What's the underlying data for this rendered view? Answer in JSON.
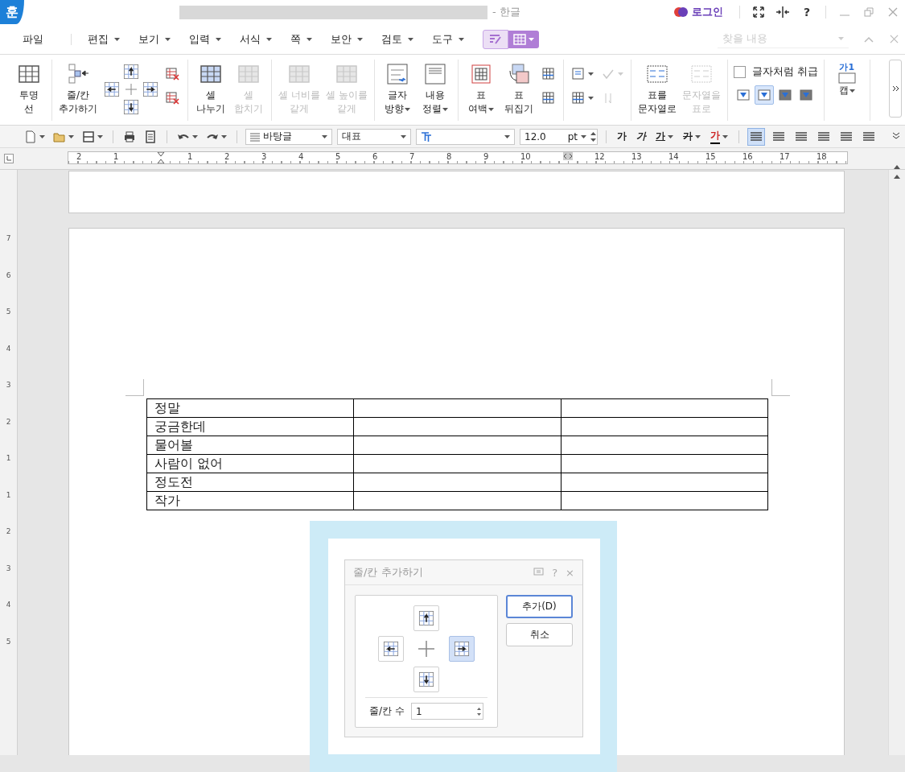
{
  "title_bar": {
    "logo": "훈",
    "app_name": "- 한글",
    "login": "로그인",
    "help": "?"
  },
  "menu": [
    {
      "label": "파일",
      "dropdown": false
    },
    {
      "label": "편집",
      "dropdown": true
    },
    {
      "label": "보기",
      "dropdown": true
    },
    {
      "label": "입력",
      "dropdown": true
    },
    {
      "label": "서식",
      "dropdown": true
    },
    {
      "label": "쪽",
      "dropdown": true
    },
    {
      "label": "보안",
      "dropdown": true
    },
    {
      "label": "검토",
      "dropdown": true
    },
    {
      "label": "도구",
      "dropdown": true
    }
  ],
  "mode_tabs": [
    {
      "selected": false
    },
    {
      "selected": true
    }
  ],
  "search": {
    "placeholder": "찾을 내용"
  },
  "ribbon": [
    {
      "items": [
        {
          "kind": "large",
          "lines": [
            "투명",
            "선"
          ],
          "disabled": false,
          "dropdown": false
        }
      ]
    },
    {
      "items": [
        {
          "kind": "large",
          "lines": [
            "줄/칸",
            "추가하기"
          ],
          "disabled": false,
          "dropdown": false
        },
        {
          "kind": "cross"
        },
        {
          "kind": "stack",
          "items": [
            {
              "kind": "small",
              "disabled": false,
              "dropdown": false
            },
            {
              "kind": "small",
              "disabled": false,
              "dropdown": false
            }
          ]
        }
      ]
    },
    {
      "items": [
        {
          "kind": "large",
          "lines": [
            "셀",
            "나누기"
          ],
          "disabled": false,
          "dropdown": false
        },
        {
          "kind": "large",
          "lines": [
            "셀",
            "합치기"
          ],
          "disabled": true,
          "dropdown": false
        }
      ]
    },
    {
      "items": [
        {
          "kind": "large",
          "lines": [
            "셀 너비를",
            "같게"
          ],
          "disabled": true,
          "dropdown": false
        },
        {
          "kind": "large",
          "lines": [
            "셀 높이를",
            "같게"
          ],
          "disabled": true,
          "dropdown": false
        }
      ]
    },
    {
      "items": [
        {
          "kind": "large",
          "lines": [
            "글자",
            "방향"
          ],
          "disabled": false,
          "dropdown": true
        },
        {
          "kind": "large",
          "lines": [
            "내용",
            "정렬"
          ],
          "disabled": false,
          "dropdown": true
        }
      ]
    },
    {
      "items": [
        {
          "kind": "large",
          "lines": [
            "표",
            "여백"
          ],
          "disabled": false,
          "dropdown": true
        },
        {
          "kind": "large",
          "lines": [
            "표",
            "뒤집기"
          ],
          "disabled": false,
          "dropdown": false
        },
        {
          "kind": "stack",
          "items": [
            {
              "kind": "small",
              "disabled": false,
              "dropdown": false
            },
            {
              "kind": "small",
              "disabled": false,
              "dropdown": false
            }
          ]
        }
      ]
    },
    {
      "items": [
        {
          "kind": "stack",
          "items": [
            {
              "kind": "small",
              "disabled": false,
              "dropdown": true
            },
            {
              "kind": "small",
              "disabled": false,
              "dropdown": true
            }
          ]
        },
        {
          "kind": "stack",
          "items": [
            {
              "kind": "small",
              "disabled": true,
              "dropdown": true
            },
            {
              "kind": "small",
              "disabled": true,
              "dropdown": false
            }
          ]
        }
      ]
    },
    {
      "items": [
        {
          "kind": "large",
          "lines": [
            "표를",
            "문자열로"
          ],
          "disabled": false,
          "dropdown": false
        },
        {
          "kind": "large",
          "lines": [
            "문자열을",
            "표로"
          ],
          "disabled": true,
          "dropdown": false
        }
      ]
    },
    {
      "items": [
        {
          "kind": "options",
          "label": "글자처럼 취급",
          "checked": false,
          "toggles": [
            {
              "selected": false
            },
            {
              "selected": true
            },
            {
              "selected": false
            },
            {
              "selected": false
            }
          ]
        }
      ]
    },
    {
      "items": [
        {
          "kind": "large",
          "icon_text": "가1",
          "lines": [
            "캡"
          ],
          "disabled": false,
          "dropdown": true
        }
      ]
    }
  ],
  "toolbar": [
    {
      "kind": "new",
      "dropdown": true
    },
    {
      "kind": "open",
      "dropdown": true
    },
    {
      "kind": "save",
      "dropdown": true
    },
    {
      "kind": "sep"
    },
    {
      "kind": "print",
      "dropdown": false
    },
    {
      "kind": "preview",
      "dropdown": false
    },
    {
      "kind": "sep"
    },
    {
      "kind": "undo",
      "dropdown": true
    },
    {
      "kind": "redo",
      "dropdown": true
    },
    {
      "kind": "sep"
    },
    {
      "kind": "style",
      "value": "바탕글"
    },
    {
      "kind": "lang",
      "value": "대표"
    },
    {
      "kind": "font"
    },
    {
      "kind": "size",
      "value": "12.0",
      "unit": "pt"
    },
    {
      "kind": "sep"
    },
    {
      "kind": "char",
      "text": "가",
      "dropdown": false
    },
    {
      "kind": "char",
      "text": "가",
      "dropdown": false
    },
    {
      "kind": "char",
      "text": "가",
      "dropdown": true
    },
    {
      "kind": "char",
      "text": "가",
      "dropdown": true
    },
    {
      "kind": "char",
      "text": "가",
      "dropdown": true
    },
    {
      "kind": "sep"
    },
    {
      "kind": "align",
      "selected": true
    },
    {
      "kind": "align",
      "selected": false
    },
    {
      "kind": "align",
      "selected": false
    },
    {
      "kind": "align",
      "selected": false
    },
    {
      "kind": "align",
      "selected": false
    },
    {
      "kind": "align",
      "selected": false
    }
  ],
  "ruler": [
    {
      "kind": "number",
      "text": "2"
    },
    {
      "kind": "number",
      "text": "1"
    },
    {
      "kind": "indent"
    },
    {
      "kind": "number",
      "text": "1"
    },
    {
      "kind": "number",
      "text": "2"
    },
    {
      "kind": "number",
      "text": "3"
    },
    {
      "kind": "number",
      "text": "4"
    },
    {
      "kind": "number",
      "text": "5"
    },
    {
      "kind": "number",
      "text": "6"
    },
    {
      "kind": "number",
      "text": "7"
    },
    {
      "kind": "number",
      "text": "8"
    },
    {
      "kind": "number",
      "text": "9"
    },
    {
      "kind": "number",
      "text": "10"
    },
    {
      "kind": "margin"
    },
    {
      "kind": "number",
      "text": "12"
    },
    {
      "kind": "number",
      "text": "13"
    },
    {
      "kind": "number",
      "text": "14"
    },
    {
      "kind": "number",
      "text": "15"
    },
    {
      "kind": "number",
      "text": "16"
    },
    {
      "kind": "number",
      "text": "17"
    },
    {
      "kind": "number",
      "text": "18"
    }
  ],
  "vruler": [
    "7",
    "6",
    "5",
    "4",
    "3",
    "2",
    "1",
    "1",
    "2",
    "3",
    "4",
    "5"
  ],
  "table": {
    "rows": [
      {
        "cells": [
          {
            "text": "정말"
          },
          {},
          {}
        ]
      },
      {
        "cells": [
          {
            "text": "궁금한데"
          },
          {},
          {}
        ]
      },
      {
        "cells": [
          {
            "text": "물어볼"
          },
          {},
          {}
        ]
      },
      {
        "cells": [
          {
            "text": "사람이 없어"
          },
          {},
          {}
        ]
      },
      {
        "cells": [
          {
            "text": "정도전"
          },
          {},
          {}
        ]
      },
      {
        "cells": [
          {
            "text": "작가"
          },
          {},
          {}
        ]
      }
    ]
  },
  "dialog": {
    "title": "줄/칸 추가하기",
    "help": "?",
    "close": "×",
    "directions": [
      {
        "kind": "up",
        "selected": false
      },
      {
        "kind": "left",
        "selected": false
      },
      {
        "kind": "right",
        "selected": true
      },
      {
        "kind": "down",
        "selected": false
      }
    ],
    "count_label": "줄/칸 수",
    "count_value": "1",
    "buttons": [
      {
        "label": "추가(D)",
        "default": true
      },
      {
        "label": "취소",
        "default": false
      }
    ]
  }
}
